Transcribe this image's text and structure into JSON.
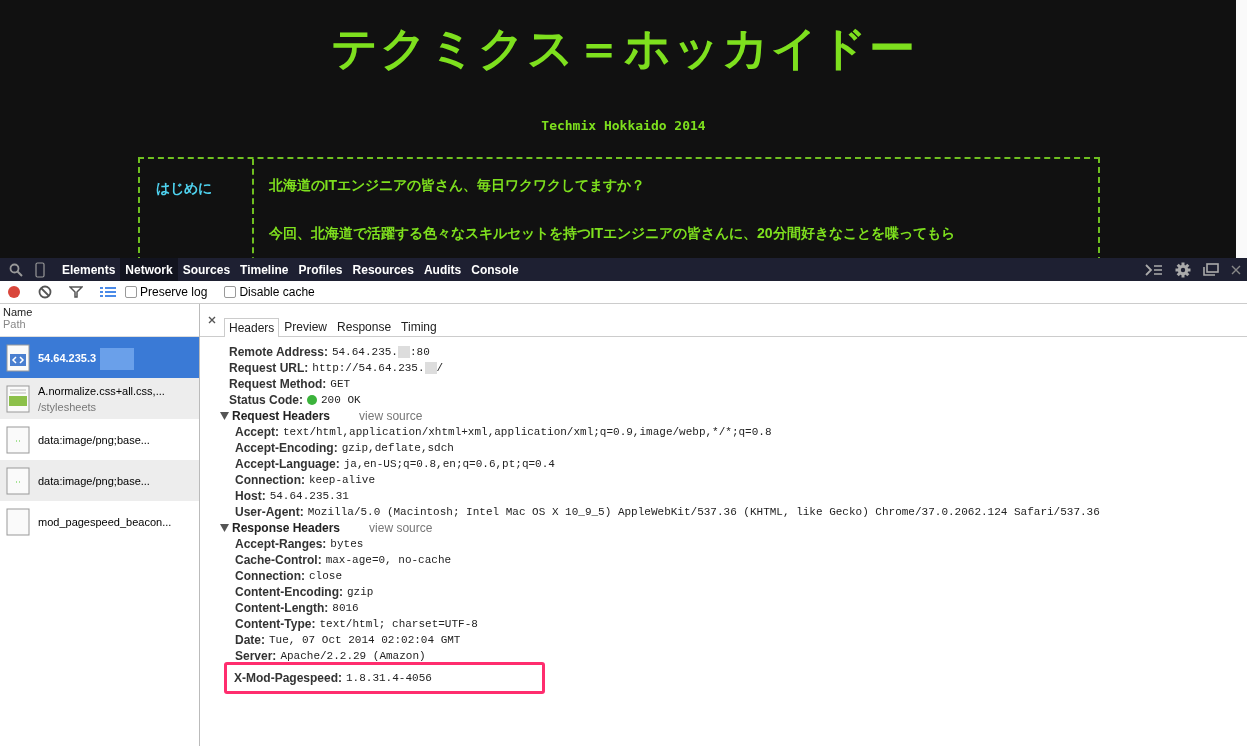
{
  "page": {
    "title": "テクミクス＝ホッカイドー",
    "subtitle": "Techmix Hokkaido 2014",
    "section_label": "はじめに",
    "paragraphs": [
      "北海道のITエンジニアの皆さん、毎日ワクワクしてますか？",
      "今回、北海道で活躍する色々なスキルセットを持つITエンジニアの皆さんに、20分間好きなことを喋ってもら"
    ]
  },
  "devtools": {
    "tabs": [
      {
        "label": "Elements",
        "selected": false
      },
      {
        "label": "Network",
        "selected": true
      },
      {
        "label": "Sources",
        "selected": false
      },
      {
        "label": "Timeline",
        "selected": false
      },
      {
        "label": "Profiles",
        "selected": false
      },
      {
        "label": "Resources",
        "selected": false
      },
      {
        "label": "Audits",
        "selected": false
      },
      {
        "label": "Console",
        "selected": false
      }
    ],
    "recording": true,
    "options": [
      {
        "label": "Preserve log",
        "checked": false
      },
      {
        "label": "Disable cache",
        "checked": false
      }
    ],
    "list_header": {
      "name": "Name",
      "path": "Path"
    },
    "requests": [
      {
        "name": "54.64.235.3",
        "kind": "html",
        "selected": true,
        "redacted": true
      },
      {
        "name": "A.normalize.css+all.css,...",
        "path": "/stylesheets",
        "kind": "css",
        "selected": false
      },
      {
        "name": "data:image/png;base...",
        "kind": "image",
        "selected": false
      },
      {
        "name": "data:image/png;base...",
        "kind": "image",
        "selected": false
      },
      {
        "name": "mod_pagespeed_beacon...",
        "kind": "blank",
        "selected": false
      }
    ],
    "detail_tabs": [
      {
        "label": "Headers",
        "selected": true
      },
      {
        "label": "Preview",
        "selected": false
      },
      {
        "label": "Response",
        "selected": false
      },
      {
        "label": "Timing",
        "selected": false
      }
    ],
    "general": [
      {
        "key": "Remote Address:",
        "value": "54.64.235.",
        "suffix": ":80",
        "redacted": true
      },
      {
        "key": "Request URL:",
        "value": "http://54.64.235.",
        "suffix": "/",
        "redacted": true
      },
      {
        "key": "Request Method:",
        "value": "GET"
      },
      {
        "key": "Status Code:",
        "value": "200 OK",
        "color": "#3bb33b"
      }
    ],
    "sections": [
      {
        "title": "Request Headers",
        "link": "view source",
        "expanded": true,
        "rows": [
          {
            "key": "Accept:",
            "value": "text/html,application/xhtml+xml,application/xml;q=0.9,image/webp,*/*;q=0.8",
            "highlighted": false
          },
          {
            "key": "Accept-Encoding:",
            "value": "gzip,deflate,sdch",
            "highlighted": false
          },
          {
            "key": "Accept-Language:",
            "value": "ja,en-US;q=0.8,en;q=0.6,pt;q=0.4",
            "highlighted": false
          },
          {
            "key": "Connection:",
            "value": "keep-alive",
            "highlighted": false
          },
          {
            "key": "Host:",
            "value": "54.64.235.31",
            "highlighted": false
          },
          {
            "key": "User-Agent:",
            "value": "Mozilla/5.0 (Macintosh; Intel Mac OS X 10_9_5) AppleWebKit/537.36 (KHTML, like Gecko) Chrome/37.0.2062.124 Safari/537.36",
            "highlighted": false
          }
        ]
      },
      {
        "title": "Response Headers",
        "link": "view source",
        "expanded": true,
        "rows": [
          {
            "key": "Accept-Ranges:",
            "value": "bytes",
            "highlighted": false
          },
          {
            "key": "Cache-Control:",
            "value": "max-age=0, no-cache",
            "highlighted": false
          },
          {
            "key": "Connection:",
            "value": "close",
            "highlighted": false
          },
          {
            "key": "Content-Encoding:",
            "value": "gzip",
            "highlighted": false
          },
          {
            "key": "Content-Length:",
            "value": "8016",
            "highlighted": false
          },
          {
            "key": "Content-Type:",
            "value": "text/html; charset=UTF-8",
            "highlighted": false
          },
          {
            "key": "Date:",
            "value": "Tue, 07 Oct 2014 02:02:04 GMT",
            "highlighted": false
          },
          {
            "key": "Server:",
            "value": "Apache/2.2.29 (Amazon)",
            "highlighted": false
          },
          {
            "key": "X-Mod-Pagespeed:",
            "value": "1.8.31.4-4056",
            "highlighted": true
          }
        ]
      }
    ]
  }
}
